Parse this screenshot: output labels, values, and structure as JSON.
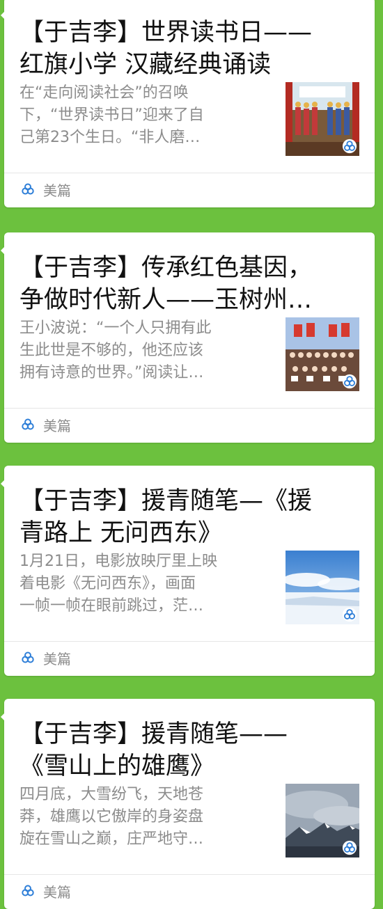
{
  "articles": [
    {
      "title_lines": [
        "【于吉李】世界读书日——",
        "红旗小学 汉藏经典诵读"
      ],
      "summary_lines": [
        "在“走向阅读社会”的召唤",
        "下，“世界读书日”迎来了自",
        "己第23个生日。“非人磨…"
      ],
      "source": "美篇"
    },
    {
      "title_lines": [
        "【于吉李】传承红色基因，",
        "争做时代新人——玉树州…"
      ],
      "summary_lines": [
        "王小波说：“一个人只拥有此",
        "生此世是不够的，他还应该",
        "拥有诗意的世界。”阅读让…"
      ],
      "source": "美篇"
    },
    {
      "title_lines": [
        "【于吉李】援青随笔—《援",
        "青路上 无问西东》"
      ],
      "summary_lines": [
        "1月21日，电影放映厅里上映",
        "着电影《无问西东》，画面",
        "一帧一帧在眼前跳过，茫…"
      ],
      "source": "美篇"
    },
    {
      "title_lines": [
        "【于吉李】援青随笔——",
        "《雪山上的雄鹰》"
      ],
      "summary_lines": [
        "四月底，大雪纷飞，天地苍",
        "莽，雄鹰以它傲岸的身姿盘",
        "旋在雪山之巅，庄严地守…"
      ],
      "source": "美篇"
    }
  ],
  "colors": {
    "background": "#6cc13e",
    "brand_icon": "#2f7fd8"
  },
  "icons": {
    "source_icon": "meipian-logo-icon"
  }
}
